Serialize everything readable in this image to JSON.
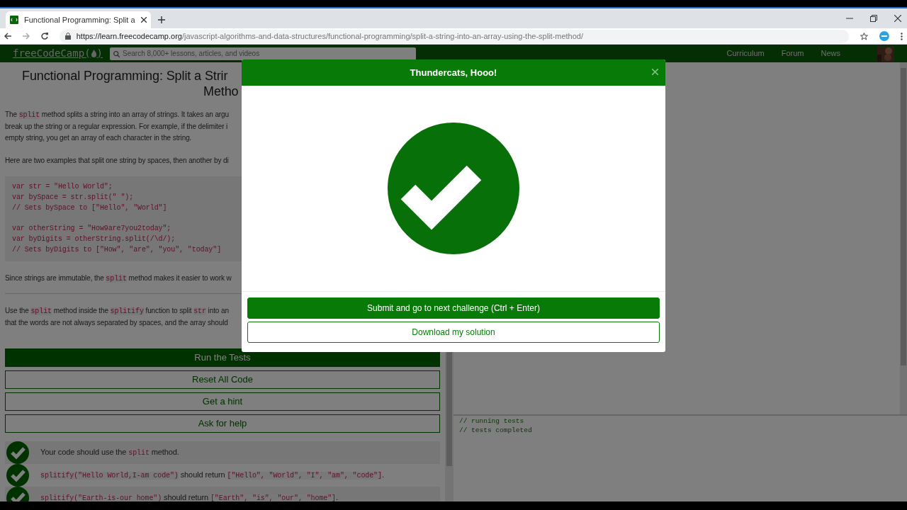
{
  "browser": {
    "tab": {
      "title": "Functional Programming: Split a",
      "selected": true
    },
    "url": {
      "host": "https://learn.freecodecamp.org",
      "path": "/javascript-algorithms-and-data-structures/functional-programming/split-a-string-into-an-array-using-the-split-method/"
    }
  },
  "site_nav": {
    "logo": [
      "freeCodeCamp(",
      ")"
    ],
    "search": {
      "placeholder": "Search 8,000+ lessons, articles, and videos"
    },
    "links": [
      "Curriculum",
      "Forum",
      "News"
    ]
  },
  "lesson": {
    "title_lines": [
      "Functional Programming: Split a Strir",
      "Metho"
    ],
    "paragraphs": [
      [
        [
          {
            "kind": "text",
            "text": "The "
          },
          {
            "kind": "code",
            "text": "split"
          },
          {
            "kind": "text",
            "text": " method splits a string into an array of strings. It takes an argu"
          }
        ],
        [
          {
            "kind": "text",
            "text": "break up the string or a regular expression. For example, if the delimiter i"
          }
        ],
        [
          {
            "kind": "text",
            "text": "empty string, you get an array of each character in the string."
          }
        ]
      ],
      [
        [
          {
            "kind": "text",
            "text": "Here are two examples that split one string by spaces, then another by di"
          }
        ]
      ]
    ],
    "code_groups": [
      [
        "var str = \"Hello World\";",
        "var bySpace = str.split(\" \");",
        "// Sets bySpace to [\"Hello\", \"World\"]"
      ],
      [
        "var otherString = \"How9are7you2today\";",
        "var byDigits = otherString.split(/\\d/);",
        "// Sets byDigits to [\"How\", \"are\", \"you\", \"today\"]"
      ]
    ],
    "after_code": [
      [
        {
          "kind": "text",
          "text": "Since strings are immutable, the "
        },
        {
          "kind": "code",
          "text": "split"
        },
        {
          "kind": "text",
          "text": " method makes it easier to work w"
        }
      ]
    ],
    "instructions": [
      [
        {
          "kind": "text",
          "text": "Use the "
        },
        {
          "kind": "code",
          "text": "split"
        },
        {
          "kind": "text",
          "text": " method inside the "
        },
        {
          "kind": "code",
          "text": "splitify"
        },
        {
          "kind": "text",
          "text": " function to split "
        },
        {
          "kind": "code",
          "text": "str"
        },
        {
          "kind": "text",
          "text": " into an"
        }
      ],
      [
        {
          "kind": "text",
          "text": "that the words are not always separated by spaces, and the array should"
        }
      ]
    ],
    "buttons": [
      {
        "label": "Run the Tests",
        "kind": "primary"
      },
      {
        "label": "Reset All Code",
        "kind": "outline"
      },
      {
        "label": "Get a hint",
        "kind": "outline"
      },
      {
        "label": "Ask for help",
        "kind": "outline"
      }
    ],
    "tests": [
      {
        "passed": true,
        "parts": [
          {
            "kind": "text",
            "text": "Your code should use the "
          },
          {
            "kind": "code",
            "text": "split"
          },
          {
            "kind": "text",
            "text": " method."
          }
        ]
      },
      {
        "passed": true,
        "parts": [
          {
            "kind": "code",
            "text": "splitify(\"Hello World,I-am code\")"
          },
          {
            "kind": "text",
            "text": " should return "
          },
          {
            "kind": "code",
            "text": "[\"Hello\", \"World\", \"I\", \"am\", \"code\"]"
          },
          {
            "kind": "text",
            "text": "."
          }
        ]
      },
      {
        "passed": true,
        "parts": [
          {
            "kind": "code",
            "text": "splitify(\"Earth-is-our home\")"
          },
          {
            "kind": "text",
            "text": " should return "
          },
          {
            "kind": "code",
            "text": "[\"Earth\", \"is\", \"our\", \"home\"]"
          },
          {
            "kind": "text",
            "text": "."
          }
        ]
      }
    ]
  },
  "console": [
    "// running tests",
    "// tests completed"
  ],
  "modal": {
    "title": "Thundercats, Hooo!",
    "buttons": [
      {
        "label": "Submit and go to next challenge (Ctrl + Enter)",
        "kind": "primary"
      },
      {
        "label": "Download my solution",
        "kind": "outline"
      }
    ]
  }
}
